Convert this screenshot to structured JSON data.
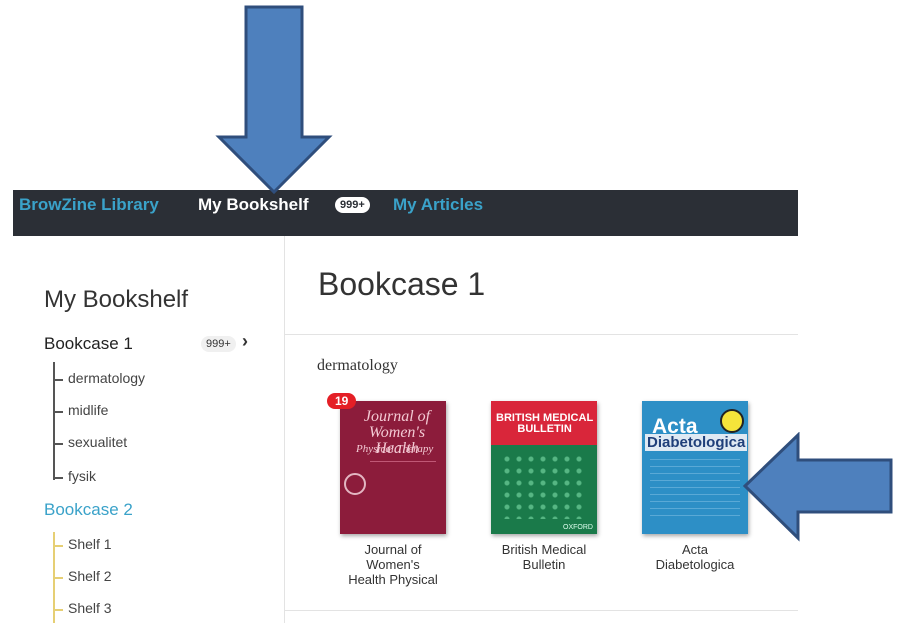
{
  "nav": {
    "browzine_library": "BrowZine Library",
    "my_bookshelf": "My Bookshelf",
    "bookshelf_badge": "999+",
    "my_articles": "My Articles"
  },
  "sidebar": {
    "title": "My Bookshelf",
    "bookcase1": {
      "label": "Bookcase 1",
      "badge": "999+",
      "chevron": "›"
    },
    "shelves1": [
      "dermatology",
      "midlife",
      "sexualitet",
      "fysik"
    ],
    "bookcase2": {
      "label": "Bookcase 2"
    },
    "shelves2": [
      "Shelf 1",
      "Shelf 2",
      "Shelf 3"
    ]
  },
  "main": {
    "title": "Bookcase 1",
    "shelf_title": "dermatology",
    "books": [
      {
        "title": "Journal of Women's Health Physical",
        "badge": "19",
        "cover_line1": "Journal of",
        "cover_line2": "Women's Health",
        "cover_line3": "Physical Therapy"
      },
      {
        "title": "British Medical Bulletin",
        "cover_line1": "BRITISH MEDICAL",
        "cover_line2": "BULLETIN",
        "cover_pub": "OXFORD"
      },
      {
        "title": "Acta Diabetologica",
        "cover_line1": "Acta",
        "cover_line2": "Diabetologica"
      }
    ]
  },
  "colors": {
    "nav_bg": "#2b2f36",
    "accent_blue": "#3aa2c9",
    "arrow_fill": "#4e80bd",
    "arrow_stroke": "#2f4e7c",
    "badge_red": "#e41f26"
  },
  "icons": {
    "down_arrow": "down-arrow-annotation",
    "left_arrow": "left-arrow-annotation"
  }
}
